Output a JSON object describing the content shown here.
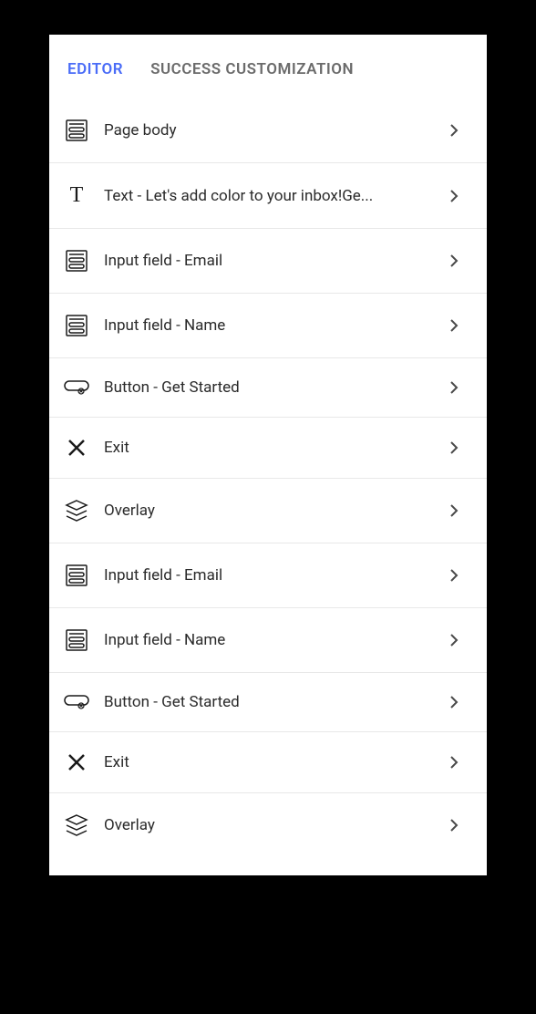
{
  "tabs": {
    "editor": "EDITOR",
    "success": "SUCCESS CUSTOMIZATION",
    "active": "editor"
  },
  "items": [
    {
      "icon": "page-body",
      "label": "Page body"
    },
    {
      "icon": "text",
      "label": "Text - Let's add color to your inbox!Ge..."
    },
    {
      "icon": "input",
      "label": "Input field - Email"
    },
    {
      "icon": "input",
      "label": "Input field - Name"
    },
    {
      "icon": "button",
      "label": "Button - Get Started"
    },
    {
      "icon": "exit",
      "label": "Exit"
    },
    {
      "icon": "overlay",
      "label": "Overlay"
    },
    {
      "icon": "input",
      "label": "Input field - Email"
    },
    {
      "icon": "input",
      "label": "Input field - Name"
    },
    {
      "icon": "button",
      "label": "Button - Get Started"
    },
    {
      "icon": "exit",
      "label": "Exit"
    },
    {
      "icon": "overlay",
      "label": "Overlay"
    }
  ]
}
